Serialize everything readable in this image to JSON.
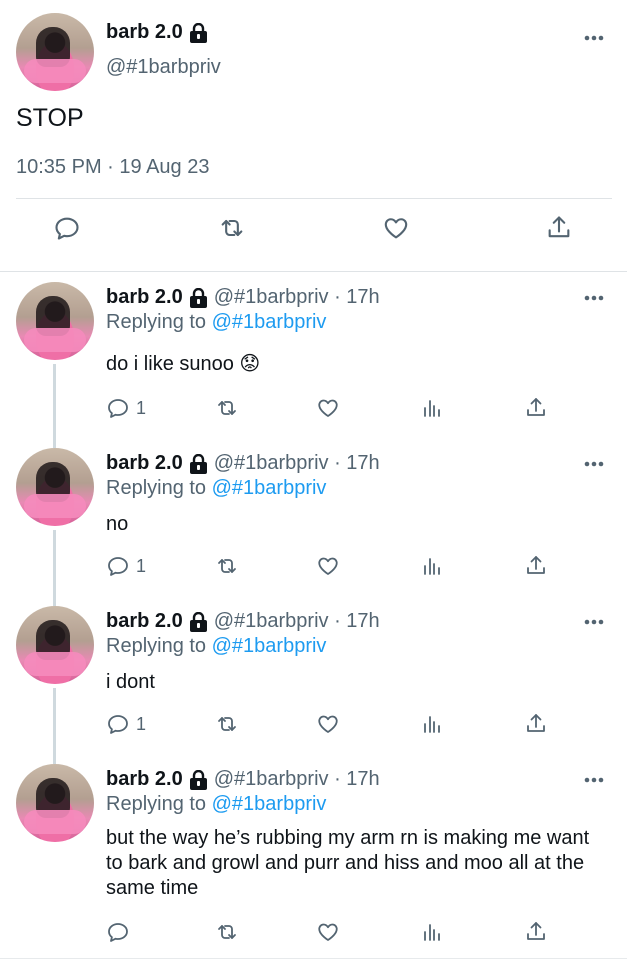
{
  "main_tweet": {
    "display_name": "barb 2.0",
    "handle": "@#1barbpriv",
    "text": "STOP",
    "timestamp": "10:35 PM · 19 Aug 23",
    "icons": [
      "comment-icon",
      "retweet-icon",
      "like-icon",
      "share-icon"
    ]
  },
  "replies": [
    {
      "display_name": "barb 2.0",
      "handle_time": "@#1barbpriv · 17h",
      "replying_prefix": "Replying to ",
      "replying_to": "@#1barbpriv",
      "text": "do i like sunoo 😟",
      "reply_count": "1"
    },
    {
      "display_name": "barb 2.0",
      "handle_time": "@#1barbpriv · 17h",
      "replying_prefix": "Replying to ",
      "replying_to": "@#1barbpriv",
      "text": "no",
      "reply_count": "1"
    },
    {
      "display_name": "barb 2.0",
      "handle_time": "@#1barbpriv · 17h",
      "replying_prefix": "Replying to ",
      "replying_to": "@#1barbpriv",
      "text": "i dont",
      "reply_count": "1"
    },
    {
      "display_name": "barb 2.0",
      "handle_time": "@#1barbpriv · 17h",
      "replying_prefix": "Replying to ",
      "replying_to": "@#1barbpriv",
      "text": "but the way he’s rubbing my arm rn is making me want to bark and growl and purr and hiss and moo all at the same time",
      "reply_count": ""
    }
  ],
  "colors": {
    "link": "#1d9bf0",
    "muted": "#536471",
    "text": "#0f1419"
  }
}
